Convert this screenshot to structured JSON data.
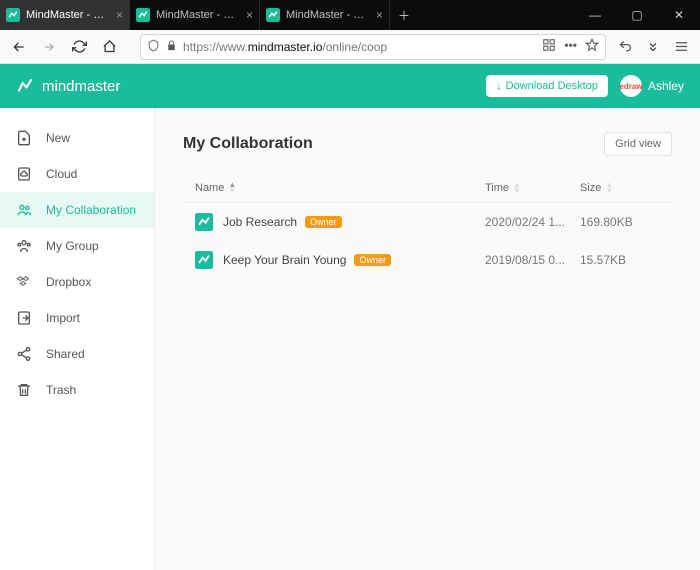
{
  "browser": {
    "tabs": [
      {
        "title": "MindMaster - Online Mind M",
        "active": true
      },
      {
        "title": "MindMaster - Online Mind M",
        "active": false
      },
      {
        "title": "MindMaster - Online Mind M",
        "active": false
      }
    ],
    "url_protocol": "https://",
    "url_prefix": "www.",
    "url_domain": "mindmaster.io",
    "url_path": "/online/coop"
  },
  "header": {
    "brand": "mindmaster",
    "download_label": "Download Desktop",
    "username": "Ashley",
    "avatar_text": "edraw"
  },
  "sidebar": {
    "items": [
      {
        "icon": "new",
        "label": "New"
      },
      {
        "icon": "cloud",
        "label": "Cloud"
      },
      {
        "icon": "collab",
        "label": "My Collaboration",
        "active": true
      },
      {
        "icon": "group",
        "label": "My Group"
      },
      {
        "icon": "dropbox",
        "label": "Dropbox"
      },
      {
        "icon": "import",
        "label": "Import"
      },
      {
        "icon": "shared",
        "label": "Shared"
      },
      {
        "icon": "trash",
        "label": "Trash"
      }
    ]
  },
  "page": {
    "title": "My Collaboration",
    "grid_view_label": "Grid view",
    "cols": {
      "name": "Name",
      "time": "Time",
      "size": "Size"
    },
    "rows": [
      {
        "name": "Job Research",
        "badge": "Owner",
        "time": "2020/02/24 1...",
        "size": "169.80KB"
      },
      {
        "name": "Keep Your Brain Young",
        "badge": "Owner",
        "time": "2019/08/15 0...",
        "size": "15.57KB"
      }
    ]
  }
}
